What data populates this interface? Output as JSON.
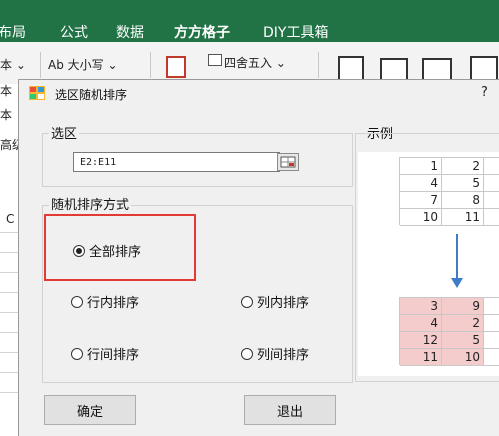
{
  "ribbon": {
    "tabs": [
      "布局",
      "公式",
      "数据",
      "方方格子",
      "DIY工具箱"
    ],
    "active_tab": "方方格子",
    "row1": {
      "left": "本 ⌄",
      "case_label": "Ab 大小写 ⌄",
      "round_label": "四舍五入 ⌄"
    },
    "side_labels": [
      "本",
      "本",
      "高级"
    ]
  },
  "sheet": {
    "column_label": "C"
  },
  "dialog": {
    "title": "选区随机排序",
    "help": "?",
    "range_group_title": "选区",
    "range_value": "E2:E11",
    "sort_group_title": "随机排序方式",
    "options": {
      "all": "全部排序",
      "in_row": "行内排序",
      "in_col": "列内排序",
      "between_rows": "行间排序",
      "between_cols": "列间排序"
    },
    "selected_option": "all",
    "ok_label": "确定",
    "exit_label": "退出",
    "example_title": "示例",
    "example_before": [
      [
        "1",
        "2"
      ],
      [
        "4",
        "5"
      ],
      [
        "7",
        "8"
      ],
      [
        "10",
        "11"
      ]
    ],
    "example_after": [
      [
        "3",
        "9"
      ],
      [
        "4",
        "2"
      ],
      [
        "12",
        "5"
      ],
      [
        "11",
        "10"
      ]
    ],
    "colors": {
      "after_fill": "#f4cccc",
      "arrow": "#3d7cc9",
      "highlight": "#e53935"
    }
  }
}
